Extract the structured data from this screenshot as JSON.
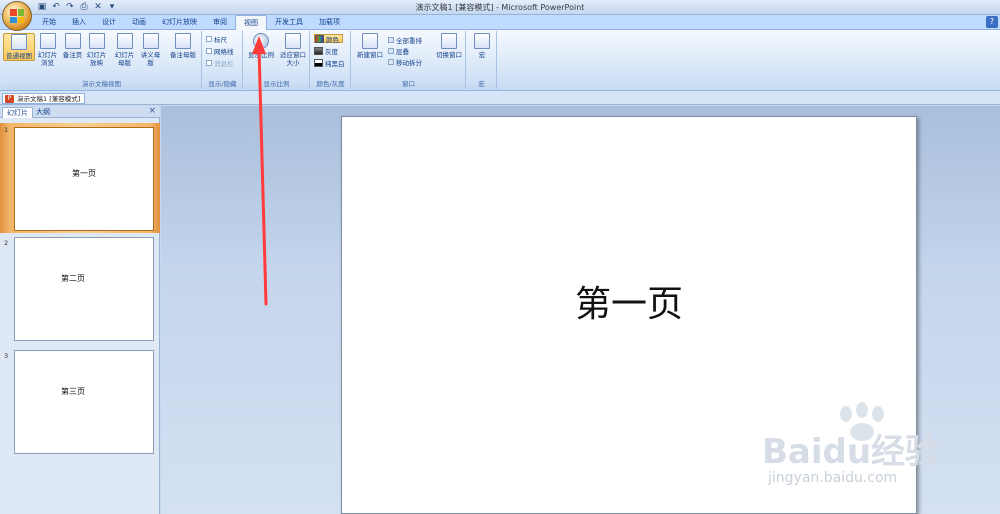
{
  "window": {
    "title": "演示文稿1 [兼容模式] - Microsoft PowerPoint"
  },
  "tabs": [
    {
      "label": "开始"
    },
    {
      "label": "插入"
    },
    {
      "label": "设计"
    },
    {
      "label": "动画"
    },
    {
      "label": "幻灯片放映"
    },
    {
      "label": "审阅"
    },
    {
      "label": "视图"
    },
    {
      "label": "开发工具"
    },
    {
      "label": "加载项"
    }
  ],
  "active_tab": "视图",
  "ribbon": {
    "presentation_views": {
      "label": "演示文稿视图",
      "buttons": [
        "普通视图",
        "幻灯片浏览",
        "备注页",
        "幻灯片放映",
        "幻灯片母版",
        "讲义母版",
        "备注母版"
      ]
    },
    "show_hide": {
      "label": "显示/隐藏",
      "items": [
        "标尺",
        "网格线",
        "消息栏"
      ]
    },
    "zoom": {
      "label": "显示比例",
      "buttons": [
        "显示比例",
        "适应窗口大小"
      ]
    },
    "color": {
      "label": "颜色/灰度",
      "items": [
        "颜色",
        "灰度",
        "纯黑白"
      ]
    },
    "window": {
      "label": "窗口",
      "new_window": "新建窗口",
      "items": [
        "全部重排",
        "层叠",
        "移动拆分"
      ],
      "switch": "切换窗口"
    },
    "macro": {
      "label": "宏",
      "button": "宏"
    }
  },
  "doc_tab": "演示文稿1 [兼容模式]",
  "pane": {
    "tab_slides": "幻灯片",
    "tab_outline": "大纲",
    "close": "×"
  },
  "slides": [
    {
      "num": "1",
      "title": "第一页"
    },
    {
      "num": "2",
      "title": "第二页"
    },
    {
      "num": "3",
      "title": "第三页"
    }
  ],
  "current_slide": {
    "title": "第一页"
  },
  "watermark": {
    "brand": "Baidu经验",
    "url": "jingyan.baidu.com"
  },
  "colors": {
    "accent": "#ff3b3b",
    "selected_thumb": "#f2b66a",
    "ribbon_bg": "#dbe8f8"
  },
  "icons": [
    "office-logo",
    "save-icon",
    "undo-icon",
    "redo-icon",
    "close-icon",
    "help-icon",
    "zoom-magnifier-icon",
    "fit-window-icon",
    "red-arrow-annotation"
  ]
}
